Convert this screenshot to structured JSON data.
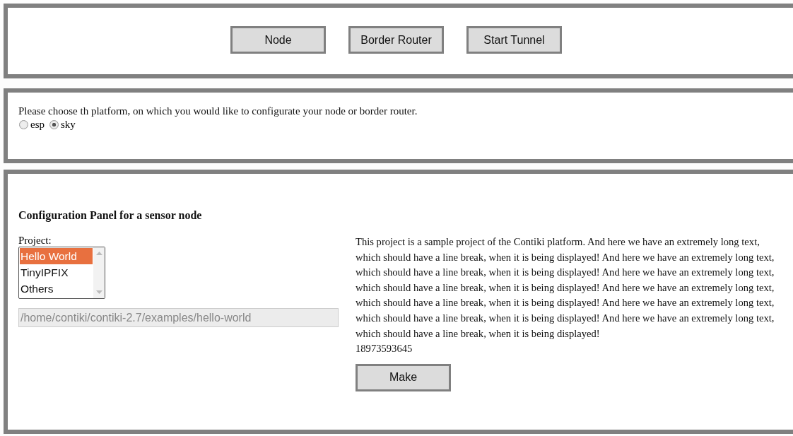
{
  "toolbar": {
    "buttons": [
      "Node",
      "Border Router",
      "Start Tunnel"
    ]
  },
  "platform": {
    "prompt": "Please choose th platform, on which you would like to configurate your node or border router.",
    "options": [
      {
        "label": "esp",
        "selected": false
      },
      {
        "label": "sky",
        "selected": true
      }
    ]
  },
  "config": {
    "title": "Configuration Panel for a sensor node",
    "project_label": "Project:",
    "projects": [
      {
        "label": "Hello World",
        "selected": true
      },
      {
        "label": "TinyIPFIX",
        "selected": false
      },
      {
        "label": "Others",
        "selected": false
      }
    ],
    "path": "/home/contiki/contiki-2.7/examples/hello-world",
    "description": "This project is a sample project of the Contiki platform. And here we have an extremely long text, which should have a line break, when it is being displayed! And here we have an extremely long text, which should have a line break, when it is being displayed! And here we have an extremely long text, which should have a line break, when it is being displayed! And here we have an extremely long text, which should have a line break, when it is being displayed! And here we have an extremely long text, which should have a line break, when it is being displayed! And here we have an extremely long text, which should have a line break, when it is being displayed!",
    "number": "18973593645",
    "action": "Make"
  }
}
